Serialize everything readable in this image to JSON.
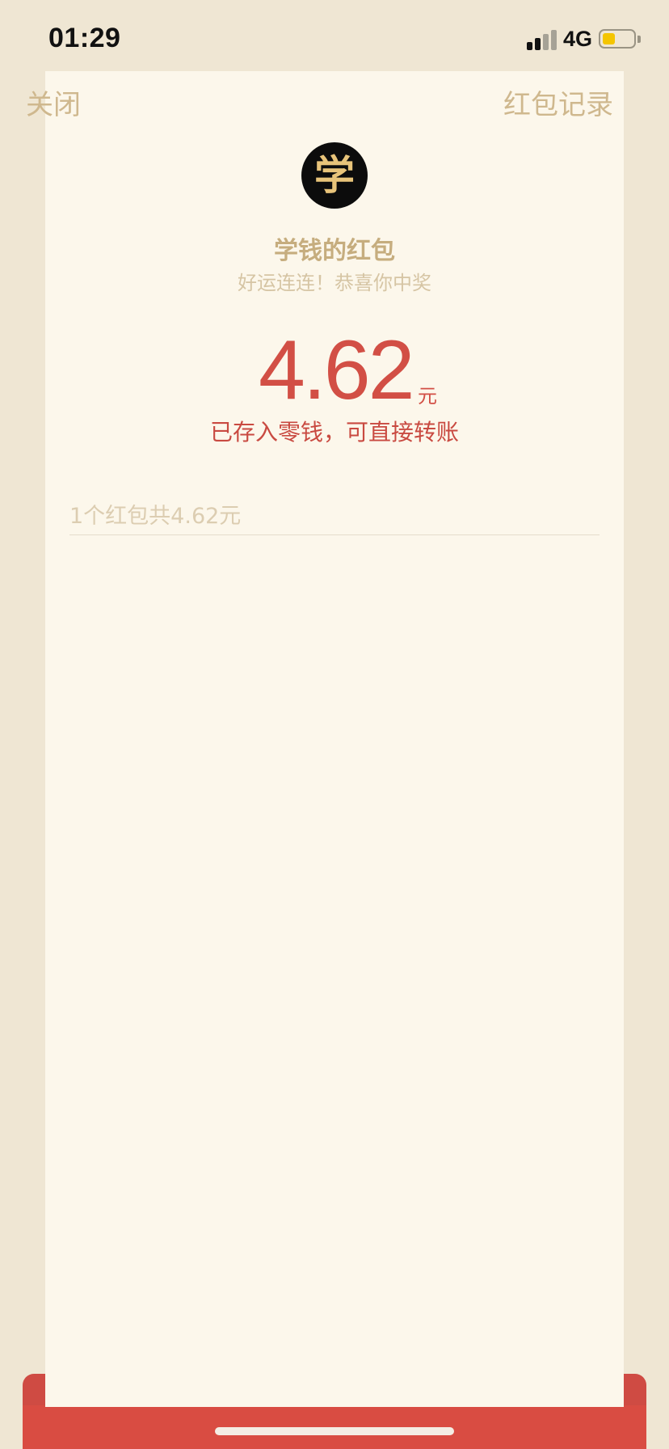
{
  "status_bar": {
    "time": "01:29",
    "network": "4G",
    "battery_level": 0.3,
    "battery_color": "#f4c500"
  },
  "nav": {
    "close_label": "关闭",
    "records_label": "红包记录"
  },
  "sender": {
    "avatar_glyph": "学",
    "name": "学钱的红包",
    "greeting": "好运连连！恭喜你中奖"
  },
  "amount": {
    "value": "4.62",
    "unit": "元",
    "note": "已存入零钱，可直接转账"
  },
  "summary": {
    "text": "1个红包共4.62元"
  },
  "colors": {
    "accent_red": "#d24f45",
    "gold_text": "#c6ad7e",
    "card_bg": "#fcf7eb",
    "page_bg": "#efe6d3"
  },
  "icons": {
    "signal": "cellular-signal-icon",
    "battery": "battery-icon"
  }
}
